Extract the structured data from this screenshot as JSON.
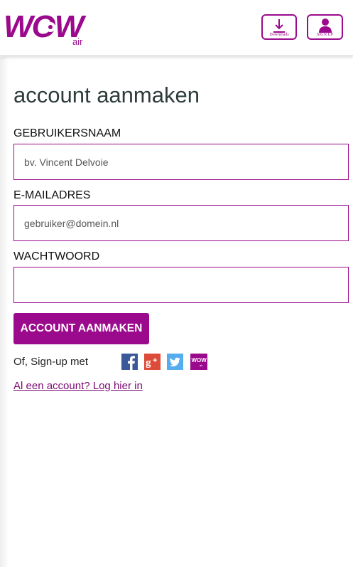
{
  "header": {
    "logo_text": "WOW",
    "logo_sub": "air",
    "downloads_label": "Downloads",
    "signup_label": "SIGN UP"
  },
  "form": {
    "title": "account aanmaken",
    "username_label": "GEBRUIKERSNAAM",
    "username_placeholder": "bv. Vincent Delvoie",
    "email_label": "E-MAILADRES",
    "email_placeholder": "gebruiker@domein.nl",
    "password_label": "WACHTWOORD",
    "password_placeholder": "",
    "submit_label": "ACCOUNT AANMAKEN"
  },
  "social": {
    "prompt": "Of, Sign-up met",
    "providers": [
      "facebook-icon",
      "google-plus-icon",
      "twitter-icon",
      "wow-icon"
    ],
    "wow_icon_text": "WOW"
  },
  "footer": {
    "login_link": "Al een account? Log hier in"
  },
  "colors": {
    "brand": "#9b0a8c",
    "title": "#2d3b3b",
    "facebook": "#3b5998",
    "google": "#dd4b39",
    "twitter": "#55acee"
  }
}
